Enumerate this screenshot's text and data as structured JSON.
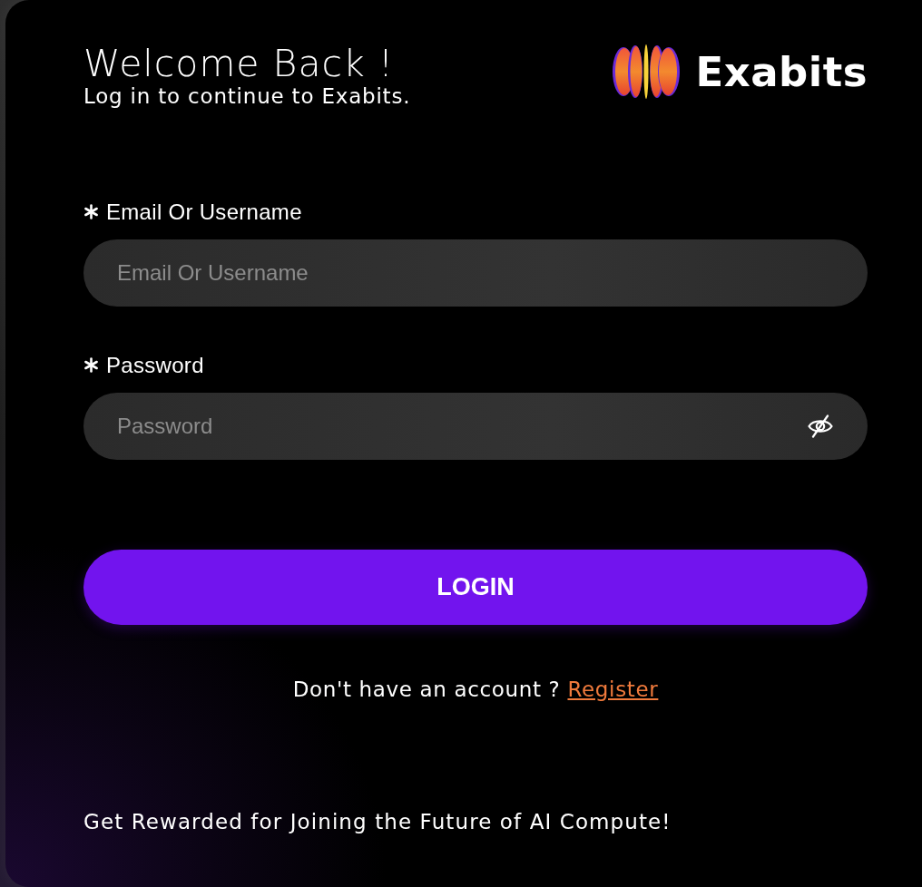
{
  "header": {
    "title": "Welcome Back !",
    "subtitle": "Log in to continue to Exabits.",
    "logo_text": "Exabits"
  },
  "fields": [
    {
      "kind": "text",
      "label": "Email Or Username",
      "required": true,
      "placeholder": "Email Or Username"
    },
    {
      "kind": "password",
      "label": "Password",
      "required": true,
      "placeholder": "Password"
    }
  ],
  "login_button": "LOGIN",
  "register_prompt": {
    "text": "Don't have an account ?",
    "link": "Register"
  },
  "footer": "Get Rewarded for Joining the Future of AI Compute!"
}
